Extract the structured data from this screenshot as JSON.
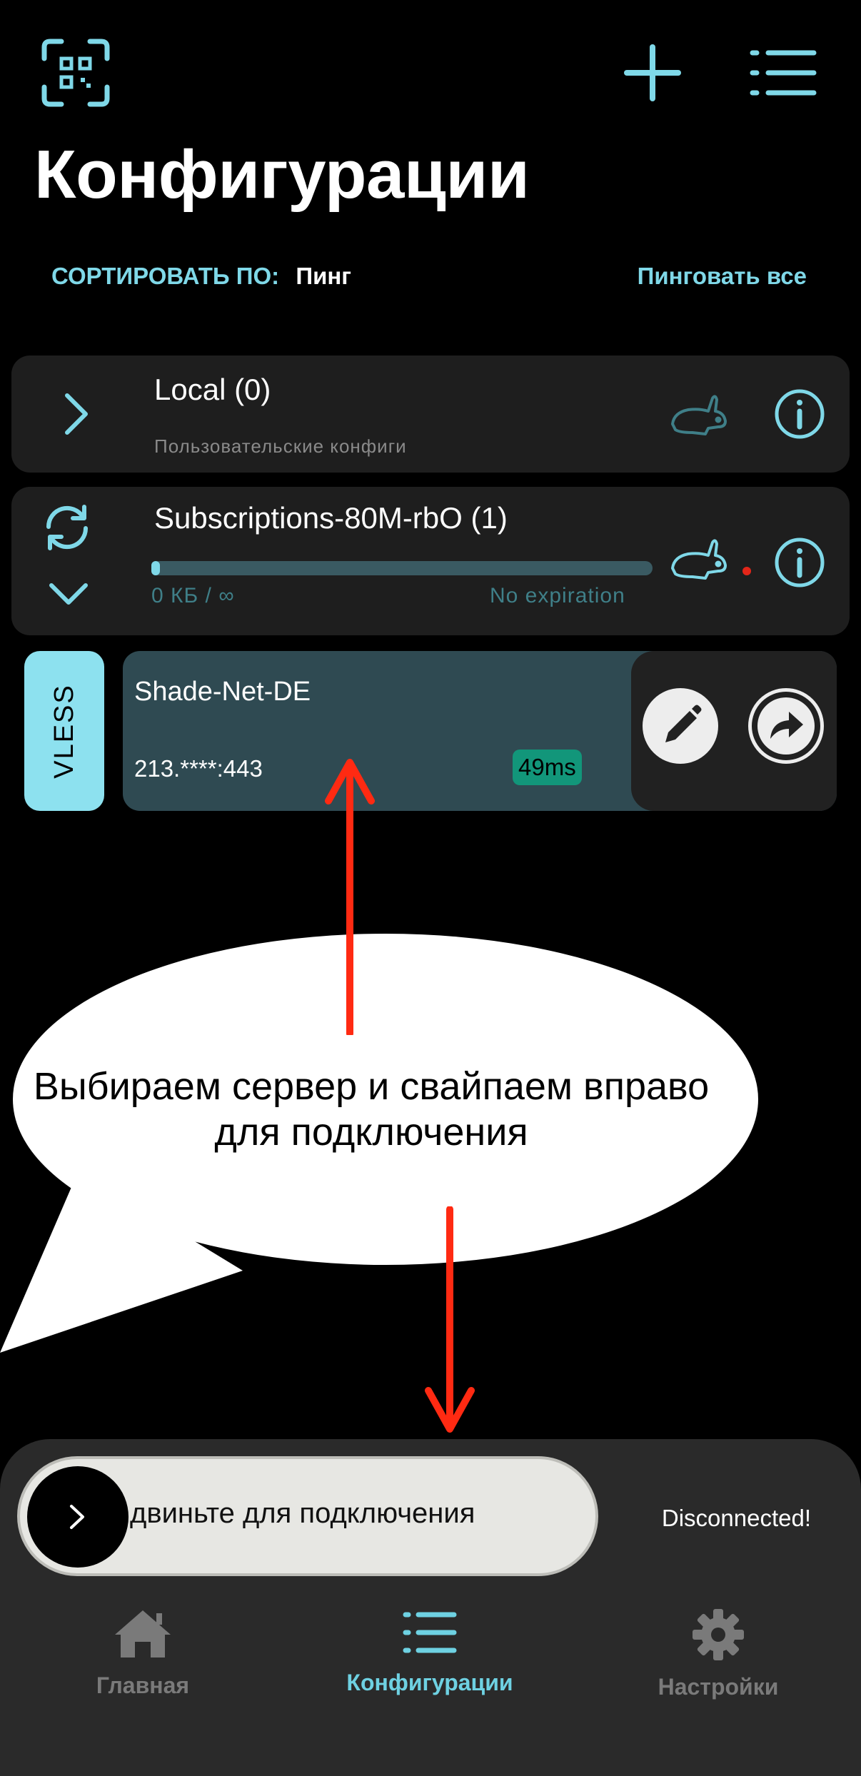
{
  "header": {
    "title": "Конфигурации",
    "sort_label": "СОРТИРОВАТЬ ПО:",
    "sort_value": "Пинг",
    "ping_all": "Пинговать все"
  },
  "groups": [
    {
      "title": "Local (0)",
      "subtitle": "Пользовательские конфиги"
    },
    {
      "title": "Subscriptions-80M-rbO (1)",
      "usage": "0 КБ / ∞",
      "expiration": "No expiration",
      "progress": 0.01
    }
  ],
  "server": {
    "protocol": "VLESS",
    "name": "Shade-Net-DE",
    "address": "213.****:443",
    "ping": "49ms"
  },
  "annotation": {
    "line1": "Выбираем сервер и свайпаем вправо",
    "line2": "для подключения"
  },
  "connect": {
    "slider_text": "двиньте для подключения",
    "status": "Disconnected!"
  },
  "nav": [
    {
      "label": "Главная",
      "icon": "home-icon",
      "active": false
    },
    {
      "label": "Конфигурации",
      "icon": "list-icon",
      "active": true
    },
    {
      "label": "Настройки",
      "icon": "gear-icon",
      "active": false
    }
  ],
  "colors": {
    "accent": "#7fd8e8",
    "ping_badge": "#12967a",
    "annotation_arrow": "#ff2a12",
    "status_dot": "#e32619"
  }
}
